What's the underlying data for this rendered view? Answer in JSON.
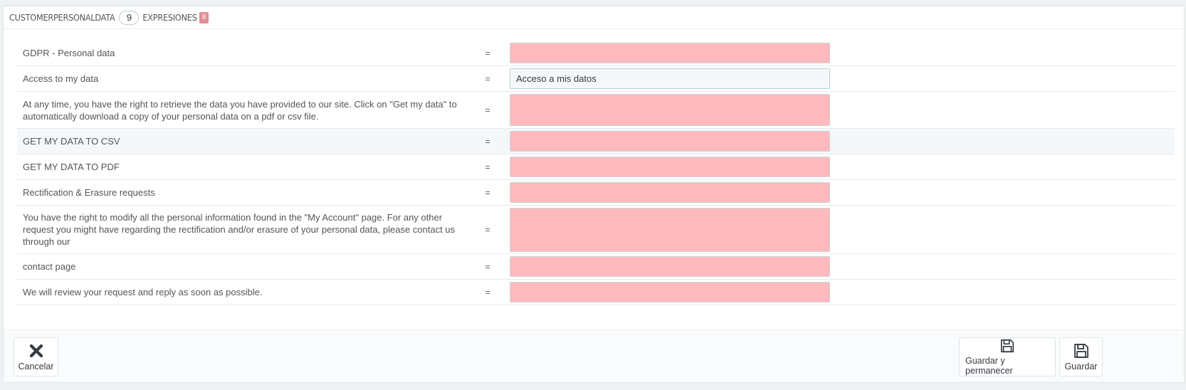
{
  "header": {
    "title": "CUSTOMERPERSONALDATA",
    "count": "9",
    "expressions_label": "EXPRESIONES",
    "missing_count": "8"
  },
  "rows": [
    {
      "source": "GDPR - Personal data",
      "eq": "=",
      "value": "",
      "missing": true
    },
    {
      "source": "Access to my data",
      "eq": "=",
      "value": "Acceso a mis datos",
      "missing": false
    },
    {
      "source": "At any time, you have the right to retrieve the data you have provided to our site. Click on \"Get my data\" to automatically download a copy of your personal data on a pdf or csv file.",
      "eq": "=",
      "value": "",
      "missing": true
    },
    {
      "source": "GET MY DATA TO CSV",
      "eq": "=",
      "value": "",
      "missing": true
    },
    {
      "source": "GET MY DATA TO PDF",
      "eq": "=",
      "value": "",
      "missing": true
    },
    {
      "source": "Rectification & Erasure requests",
      "eq": "=",
      "value": "",
      "missing": true
    },
    {
      "source": "You have the right to modify all the personal information found in the \"My Account\" page. For any other request you might have regarding the rectification and/or erasure of your personal data, please contact us through our",
      "eq": "=",
      "value": "",
      "missing": true
    },
    {
      "source": "contact page",
      "eq": "=",
      "value": "",
      "missing": true
    },
    {
      "source": "We will review your request and reply as soon as possible.",
      "eq": "=",
      "value": "",
      "missing": true
    }
  ],
  "footer": {
    "cancel_label": "Cancelar",
    "save_stay_label": "Guardar y permanecer",
    "save_label": "Guardar"
  },
  "colors": {
    "missing_field": "#ffbabe",
    "badge_missing": "#e08f95"
  }
}
